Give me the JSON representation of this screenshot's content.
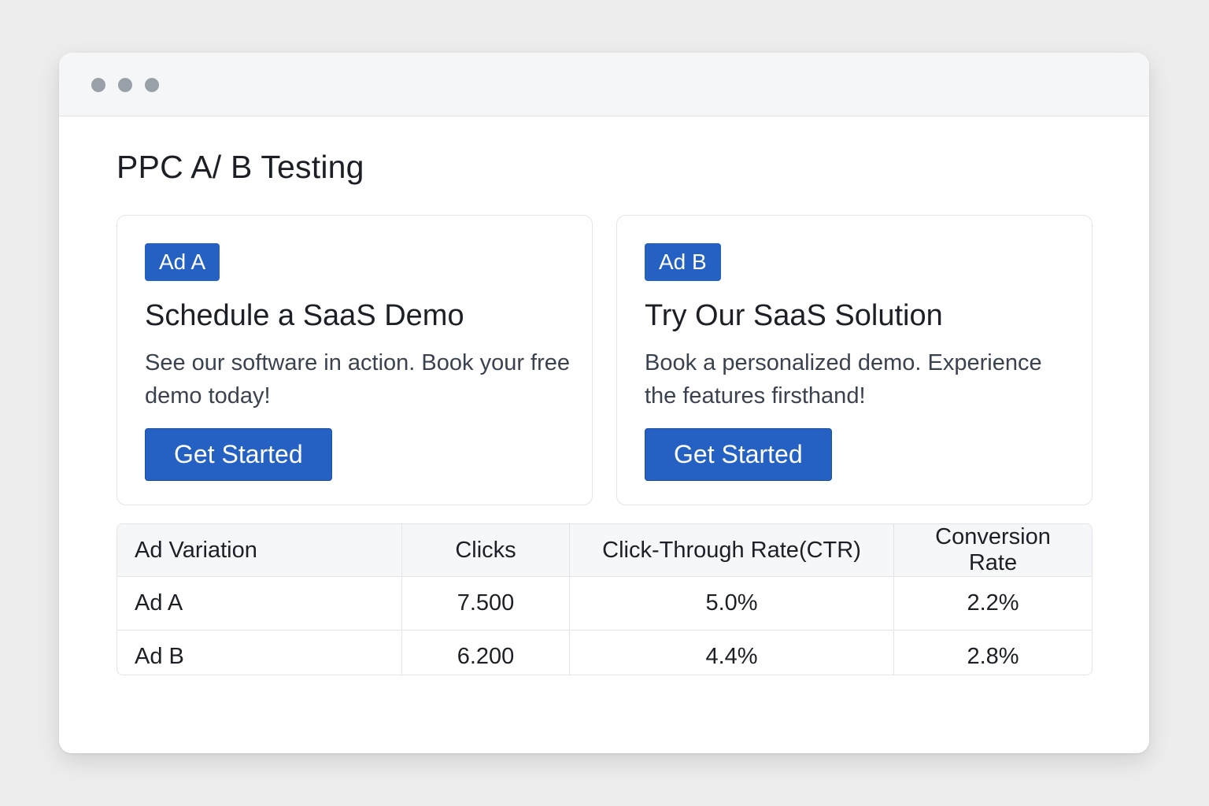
{
  "window": {
    "controls": [
      "window-dot",
      "window-dot",
      "window-dot"
    ]
  },
  "page": {
    "title": "PPC A/ B Testing"
  },
  "ads": [
    {
      "badge": "Ad A",
      "headline": "Schedule a SaaS Demo",
      "description": "See our software in action. Book your free demo today!",
      "cta_label": "Get Started"
    },
    {
      "badge": "Ad B",
      "headline": "Try Our SaaS Solution",
      "description": "Book a personalized demo. Experience the features firsthand!",
      "cta_label": "Get Started"
    }
  ],
  "table": {
    "headers": [
      "Ad Variation",
      "Clicks",
      "Click-Through Rate(CTR)",
      "Conversion Rate"
    ],
    "rows": [
      [
        "Ad A",
        "7.500",
        "5.0%",
        "2.2%"
      ],
      [
        "Ad B",
        "6.200",
        "4.4%",
        "2.8%"
      ]
    ]
  },
  "colors": {
    "accent": "#2461c2",
    "background": "#ededee",
    "text": "#1c2026"
  }
}
